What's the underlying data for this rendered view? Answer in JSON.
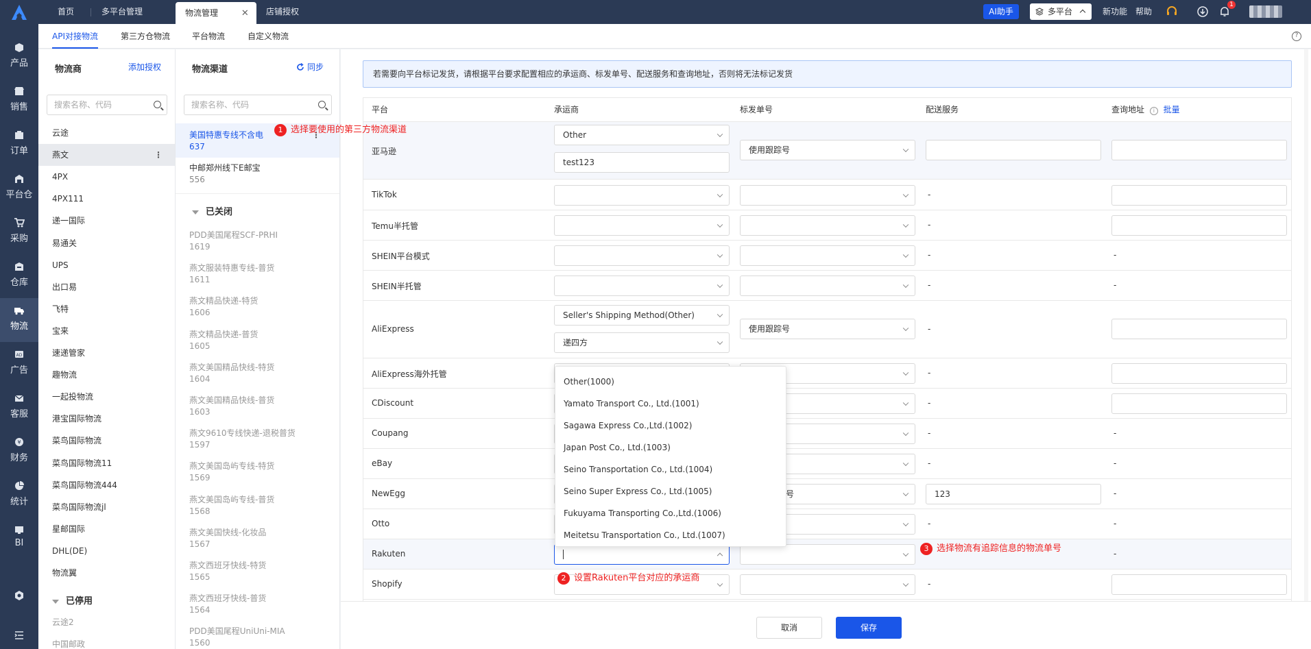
{
  "colors": {
    "nav_bg": "#2b3a55",
    "accent": "#1a56e8",
    "annotation": "#e22222"
  },
  "topbar": {
    "tabs": [
      {
        "label": "首页"
      },
      {
        "label": "多平台管理"
      },
      {
        "label": "物流管理",
        "active": true,
        "close": "✕"
      },
      {
        "label": "店铺授权"
      }
    ],
    "ai_label": "AI助手",
    "platform_label": "多平台",
    "new_features": "新功能",
    "help": "帮助",
    "notification_count": "1",
    "icons": [
      "logo-icon",
      "headset-icon",
      "download-icon",
      "bell-icon"
    ]
  },
  "leftnav": {
    "items": [
      {
        "label": "产品",
        "icon": "box-icon"
      },
      {
        "label": "销售",
        "icon": "shop-icon"
      },
      {
        "label": "订单",
        "icon": "order-icon"
      },
      {
        "label": "平台仓",
        "icon": "warehouse-icon"
      },
      {
        "label": "采购",
        "icon": "cart-icon"
      },
      {
        "label": "仓库",
        "icon": "storage-icon"
      },
      {
        "label": "物流",
        "icon": "truck-icon",
        "active": true
      },
      {
        "label": "广告",
        "icon": "ad-icon"
      },
      {
        "label": "客服",
        "icon": "mail-icon"
      },
      {
        "label": "财务",
        "icon": "finance-icon"
      },
      {
        "label": "统计",
        "icon": "pie-icon"
      },
      {
        "label": "BI",
        "icon": "bi-icon"
      }
    ]
  },
  "subtabs": [
    {
      "label": "API对接物流",
      "active": true
    },
    {
      "label": "第三方仓物流"
    },
    {
      "label": "平台物流"
    },
    {
      "label": "自定义物流"
    }
  ],
  "carriers": {
    "title": "物流商",
    "add_label": "添加授权",
    "search_placeholder": "搜索名称、代码",
    "items": [
      "云途",
      "燕文",
      "4PX",
      "4PX111",
      "递一国际",
      "易通关",
      "UPS",
      "出口易",
      "飞特",
      "宝来",
      "速递管家",
      "趣物流",
      "一起投物流",
      "港宝国际物流",
      "菜鸟国际物流",
      "菜鸟国际物流11",
      "菜鸟国际物流444",
      "菜鸟国际物流jl",
      "星邮国际",
      "DHL(DE)",
      "物流翼"
    ],
    "active_index": 1,
    "disabled_title": "已停用",
    "disabled_items": [
      "云途2",
      "中国邮政"
    ]
  },
  "channels": {
    "title": "物流渠道",
    "sync_label": "同步",
    "search_placeholder": "搜索名称、代码",
    "open": [
      {
        "name": "美国特惠专线不含电",
        "code": "637",
        "active": true
      },
      {
        "name": "中邮郑州线下E邮宝",
        "code": "556"
      }
    ],
    "closed_title": "已关闭",
    "closed": [
      {
        "name": "PDD美国尾程SCF-PRHI",
        "code": "1619"
      },
      {
        "name": "燕文服装特惠专线-普货",
        "code": "1611"
      },
      {
        "name": "燕文精品快递-特货",
        "code": "1606"
      },
      {
        "name": "燕文精品快递-普货",
        "code": "1605"
      },
      {
        "name": "燕文美国精品快线-特货",
        "code": "1604"
      },
      {
        "name": "燕文美国精品快线-普货",
        "code": "1603"
      },
      {
        "name": "燕文9610专线快递-退税普货",
        "code": "1597"
      },
      {
        "name": "燕文美国岛屿专线-特货",
        "code": "1569"
      },
      {
        "name": "燕文美国岛屿专线-普货",
        "code": "1568"
      },
      {
        "name": "燕文美国快线-化妆品",
        "code": "1567"
      },
      {
        "name": "燕文西班牙快线-特货",
        "code": "1565"
      },
      {
        "name": "燕文西班牙快线-普货",
        "code": "1564"
      },
      {
        "name": "PDD美国尾程UniUni-MIA",
        "code": "1560"
      }
    ]
  },
  "main": {
    "notice": "若需要向平台标记发货，请根据平台要求配置相应的承运商、标发单号、配送服务和查询地址，否则将无法标记发货",
    "headers": {
      "platform": "平台",
      "carrier": "承运商",
      "tracking": "标发单号",
      "service": "配送服务",
      "query": "查询地址",
      "batch": "批量"
    },
    "rows": {
      "amazon": {
        "name": "亚马逊",
        "carrier": "Other",
        "carrier_text": "test123",
        "tracking": "使用跟踪号"
      },
      "tiktok": {
        "name": "TikTok",
        "service": "-"
      },
      "temu": {
        "name": "Temu半托管",
        "service": "-"
      },
      "shein_platform": {
        "name": "SHEIN平台模式",
        "service": "-",
        "query": "-"
      },
      "shein_semi": {
        "name": "SHEIN半托管",
        "service": "-",
        "query": "-"
      },
      "aliexpress": {
        "name": "AliExpress",
        "carrier": "Seller's Shipping Method(Other)",
        "carrier2": "递四方",
        "tracking": "使用跟踪号",
        "service": "-"
      },
      "aliexpress_overseas": {
        "name": "AliExpress海外托管",
        "service": "-"
      },
      "cdiscount": {
        "name": "CDiscount",
        "service": "-"
      },
      "coupang": {
        "name": "Coupang",
        "service": "-",
        "query": "-"
      },
      "ebay": {
        "name": "eBay",
        "service": "-",
        "query": "-"
      },
      "newegg": {
        "name": "NewEgg",
        "tracking_partial": "号",
        "service": "123",
        "query": "-"
      },
      "otto": {
        "name": "Otto",
        "service": "-",
        "query": "-"
      },
      "rakuten": {
        "name": "Rakuten",
        "query": "-"
      },
      "shopify": {
        "name": "Shopify",
        "service": "-"
      }
    },
    "dropdown_options": [
      "Other(1000)",
      "Yamato Transport Co., Ltd.(1001)",
      "Sagawa Express Co.,Ltd.(1002)",
      "Japan Post Co., Ltd.(1003)",
      "Seino Transportation Co., Ltd.(1004)",
      "Seino Super Express Co., Ltd.(1005)",
      "Fukuyama Transporting Co.,Ltd.(1006)",
      "Meitetsu Transportation Co., Ltd.(1007)"
    ]
  },
  "annotations": [
    {
      "num": "1",
      "text": "选择要使用的第三方物流渠道"
    },
    {
      "num": "2",
      "text": "设置Rakuten平台对应的承运商"
    },
    {
      "num": "3",
      "text": "选择物流有追踪信息的物流单号"
    }
  ],
  "footer": {
    "cancel": "取消",
    "save": "保存"
  }
}
